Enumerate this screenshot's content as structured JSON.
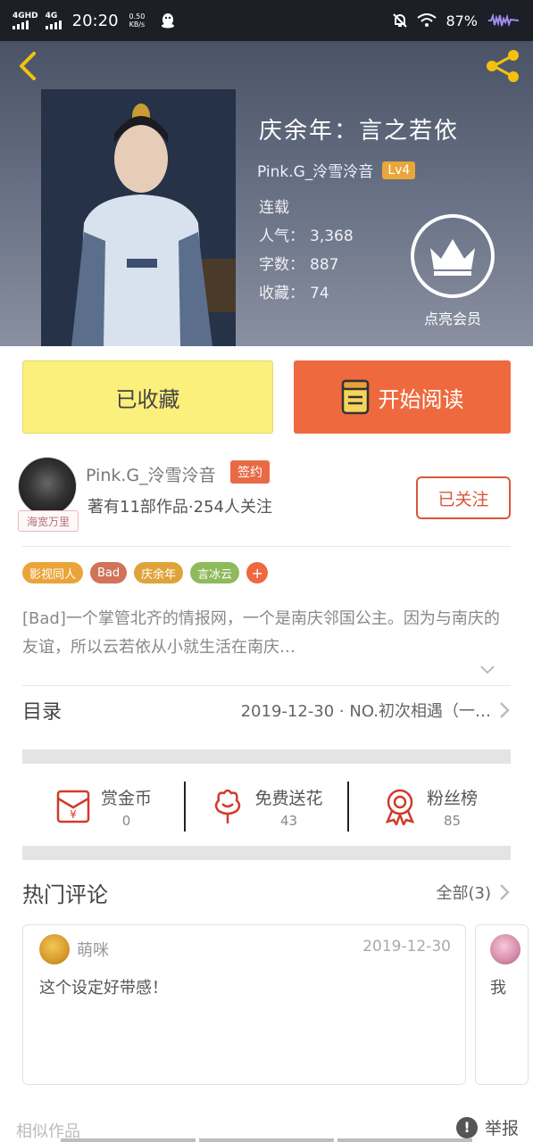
{
  "status_bar": {
    "network1": "4GHD",
    "network2": "4G",
    "time": "20:20",
    "speed_value": "0.50",
    "speed_unit": "KB/s",
    "battery": "87%"
  },
  "hero": {
    "title": "庆余年：言之若依",
    "author": "Pink.G_泠雪泠音",
    "level": "Lv4",
    "status": "连载",
    "popularity_label": "人气：",
    "popularity": "3,368",
    "words_label": "字数：",
    "words": "887",
    "favorites_label": "收藏：",
    "favorites": "74",
    "vip_label": "点亮会员"
  },
  "actions": {
    "favorited_label": "已收藏",
    "read_label": "开始阅读"
  },
  "author_card": {
    "avatar_tag": "海宽万里",
    "name": "Pink.G_泠雪泠音",
    "sign_badge": "签约",
    "stats": "著有11部作品·254人关注",
    "follow_label": "已关注"
  },
  "tags": [
    {
      "label": "影视同人",
      "color": "#eaa43a"
    },
    {
      "label": "Bad",
      "color": "#d0735a"
    },
    {
      "label": "庆余年",
      "color": "#e0a33a"
    },
    {
      "label": "言冰云",
      "color": "#8fba5c"
    }
  ],
  "tag_more": "+",
  "description": "[Bad]一个掌管北齐的情报网，一个是南庆邻国公主。因为与南庆的友谊，所以云若依从小就生活在南庆…",
  "toc": {
    "label": "目录",
    "latest": "2019-12-30 · NO.初次相遇（一…"
  },
  "stats": [
    {
      "label": "赏金币",
      "value": "0",
      "icon": "red-envelope-icon"
    },
    {
      "label": "免费送花",
      "value": "43",
      "icon": "flower-icon"
    },
    {
      "label": "粉丝榜",
      "value": "85",
      "icon": "medal-icon"
    }
  ],
  "comments_section": {
    "title": "热门评论",
    "all_label": "全部(3)"
  },
  "comments": [
    {
      "name": "萌咪",
      "date": "2019-12-30",
      "text": "这个设定好带感！"
    },
    {
      "text": "我"
    }
  ],
  "footer": {
    "similar_label": "相似作品",
    "report_label": "举报"
  },
  "colors": {
    "accent": "#ee6a3e",
    "favorited_bg": "#fcf07c",
    "badge": "#e9a63a",
    "follow": "#d8563a"
  }
}
